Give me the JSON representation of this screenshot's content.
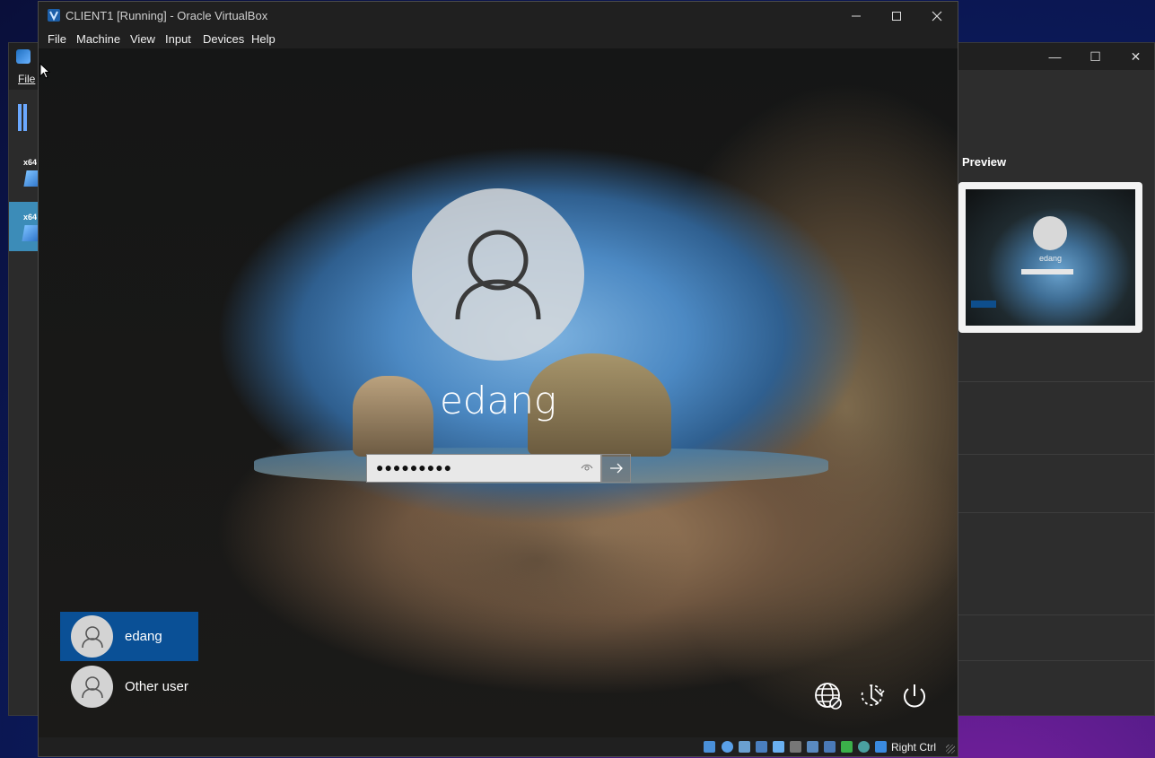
{
  "manager": {
    "menu_file": "File",
    "vm_badge_1": "x64",
    "vm_badge_2": "x64",
    "preview_title": "Preview",
    "preview_username": "edang",
    "minimize": "—",
    "maximize": "☐",
    "close": "✕"
  },
  "vm_window": {
    "title": "CLIENT1 [Running] - Oracle VirtualBox",
    "menu": [
      "File",
      "Machine",
      "View",
      "Input",
      "Devices",
      "Help"
    ]
  },
  "login": {
    "username": "edang",
    "password_mask": "●●●●●●●●●",
    "users": [
      {
        "label": "edang",
        "selected": true
      },
      {
        "label": "Other user",
        "selected": false
      }
    ],
    "system_icons": [
      "network-icon",
      "accessibility-icon",
      "power-icon"
    ]
  },
  "statusbar": {
    "host_key": "Right Ctrl",
    "icons": [
      "hdd-icon",
      "optical-icon",
      "audio-icon",
      "network-icon",
      "usb-icon",
      "shared-folder-icon",
      "display-icon",
      "recording-icon",
      "cpu-icon",
      "mouse-icon",
      "keyboard-icon"
    ]
  },
  "colors": {
    "selected_tile": "#0a5096",
    "titlebar": "#202020",
    "accent": "#3c8cb8"
  }
}
